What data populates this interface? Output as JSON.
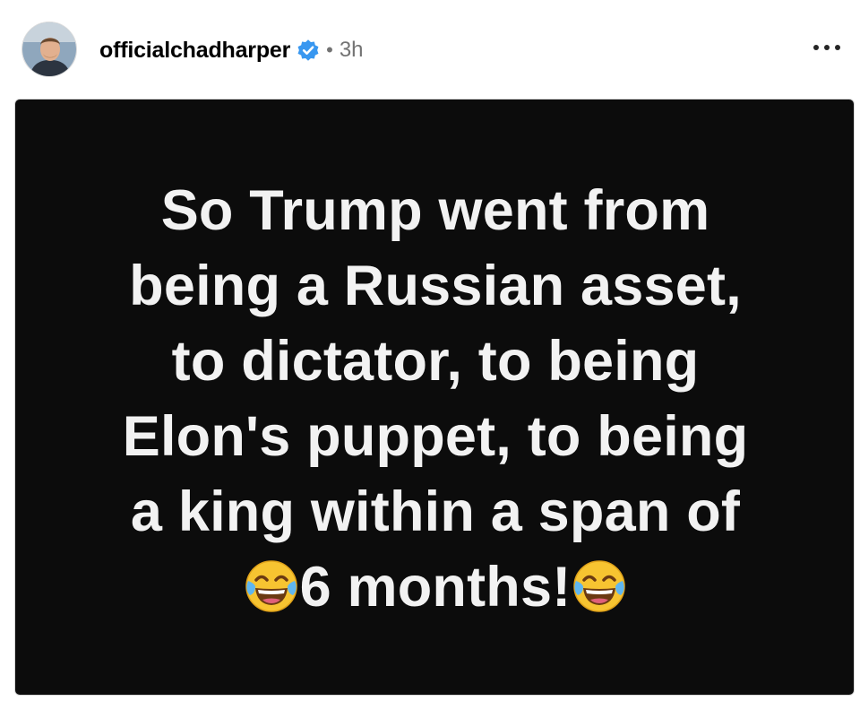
{
  "post": {
    "username": "officialchadharper",
    "separator": "•",
    "timestamp": "3h",
    "verified": true,
    "more_icon": "ellipsis-horizontal-icon",
    "avatar_icon": "user-avatar-photo",
    "verified_icon": "verified-badge-icon",
    "image": {
      "background_color": "#0c0c0c",
      "text_color": "#f2f2f2",
      "lines": [
        "So Trump went from",
        "being a Russian asset,",
        "to dictator, to being",
        "Elon's puppet, to being",
        "a king within a span of"
      ],
      "last_line_text": "6 months!",
      "emoji": "face-with-tears-of-joy-emoji"
    }
  },
  "colors": {
    "verified_blue": "#3897f0",
    "meta_gray": "#737373"
  }
}
